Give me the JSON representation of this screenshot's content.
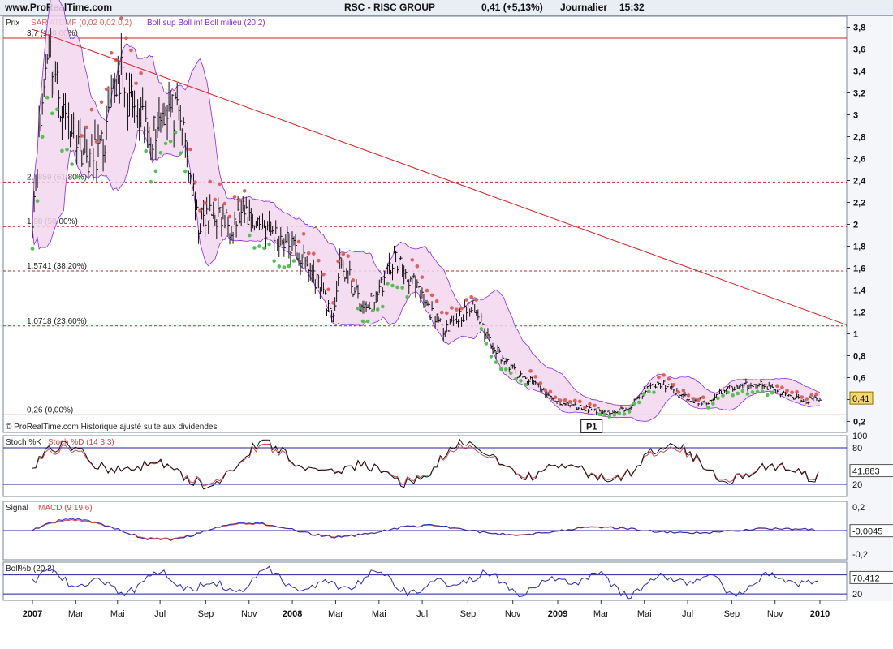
{
  "header": {
    "site": "www.ProRealTime.com",
    "ticker": "RSC - RISC GROUP",
    "price": "0,41 (+5,13%)",
    "period": "Journalier",
    "time": "15:32"
  },
  "colors": {
    "price_bars": "#111111",
    "sar_up": "#55c155",
    "sar_down": "#e06060",
    "bollinger_band": "#8a2be2",
    "bollinger_fill": "#f2d6ee",
    "fib_line": "#cc2222",
    "trend_line": "#dd2222",
    "stoch_k": "#111111",
    "stoch_d": "#d24a4a",
    "macd": "#2b2bb8",
    "signal": "#d24a4a",
    "bollpb": "#2b2bb8",
    "guide_line": "#22229a"
  },
  "chart_data": [
    {
      "type": "line",
      "panel": "price",
      "label": "Prix",
      "legend": [
        "SAR ATDMF (0,02 0,02 0,2)",
        "Boll sup Boll inf Boll milieu (20 2)"
      ],
      "ylim": [
        0.1,
        3.9
      ],
      "yticks": [
        "3,8",
        "3,6",
        "3,4",
        "3,2",
        "3",
        "2,8",
        "2,6",
        "2,4",
        "2,2",
        "2",
        "1,8",
        "1,6",
        "1,4",
        "1,2",
        "1",
        "0,8",
        "0,6",
        "0,4",
        "0,2"
      ],
      "x_labels": [
        {
          "label": "2007",
          "t": 0.0,
          "bold": true
        },
        {
          "label": "Mar",
          "t": 0.055
        },
        {
          "label": "Mai",
          "t": 0.108
        },
        {
          "label": "Jul",
          "t": 0.162
        },
        {
          "label": "Sep",
          "t": 0.22
        },
        {
          "label": "Nov",
          "t": 0.275
        },
        {
          "label": "2008",
          "t": 0.33,
          "bold": true
        },
        {
          "label": "Mar",
          "t": 0.385
        },
        {
          "label": "Mai",
          "t": 0.44
        },
        {
          "label": "Jul",
          "t": 0.495
        },
        {
          "label": "Sep",
          "t": 0.553
        },
        {
          "label": "Nov",
          "t": 0.61
        },
        {
          "label": "2009",
          "t": 0.667,
          "bold": true
        },
        {
          "label": "Mar",
          "t": 0.722
        },
        {
          "label": "Mai",
          "t": 0.777
        },
        {
          "label": "Jul",
          "t": 0.832
        },
        {
          "label": "Sep",
          "t": 0.888
        },
        {
          "label": "Nov",
          "t": 0.943
        },
        {
          "label": "2010",
          "t": 1.0,
          "bold": true
        }
      ],
      "fib_levels": [
        {
          "value": 3.7,
          "label": "3,7 (100,00%)"
        },
        {
          "value": 2.3859,
          "label": "2,3859 (61,80%)"
        },
        {
          "value": 1.98,
          "label": "1,98 (50,00%)"
        },
        {
          "value": 1.5741,
          "label": "1,5741 (38,20%)"
        },
        {
          "value": 1.0718,
          "label": "1,0718 (23,60%)"
        },
        {
          "value": 0.26,
          "label": "0,26 (0,00%)"
        }
      ],
      "trendline": {
        "from": [
          0.0,
          3.78
        ],
        "to": [
          1.0,
          1.17
        ]
      },
      "price_series": {
        "t": [
          0,
          0.01,
          0.02,
          0.03,
          0.04,
          0.05,
          0.07,
          0.09,
          0.11,
          0.13,
          0.15,
          0.17,
          0.19,
          0.21,
          0.23,
          0.25,
          0.27,
          0.29,
          0.31,
          0.33,
          0.35,
          0.37,
          0.38,
          0.39,
          0.4,
          0.42,
          0.44,
          0.46,
          0.48,
          0.5,
          0.52,
          0.54,
          0.56,
          0.58,
          0.6,
          0.62,
          0.64,
          0.66,
          0.68,
          0.7,
          0.72,
          0.74,
          0.76,
          0.78,
          0.8,
          0.82,
          0.84,
          0.86,
          0.88,
          0.9,
          0.92,
          0.94,
          0.96,
          0.98,
          1.0
        ],
        "close": [
          2.1,
          2.9,
          3.7,
          3.3,
          3.0,
          2.9,
          2.6,
          2.7,
          3.4,
          3.0,
          2.8,
          3.1,
          2.9,
          2.0,
          2.1,
          2.0,
          2.1,
          2.0,
          1.9,
          1.8,
          1.6,
          1.4,
          1.1,
          1.6,
          1.55,
          1.2,
          1.4,
          1.7,
          1.5,
          1.25,
          1.05,
          1.15,
          1.25,
          0.95,
          0.75,
          0.6,
          0.55,
          0.4,
          0.35,
          0.32,
          0.3,
          0.27,
          0.35,
          0.5,
          0.55,
          0.45,
          0.38,
          0.38,
          0.5,
          0.52,
          0.55,
          0.5,
          0.42,
          0.39,
          0.41
        ]
      },
      "last_value": "0,41",
      "annotation": "P1",
      "footnote": "© ProRealTime.com Historique ajusté suite aux dividendes"
    },
    {
      "type": "line",
      "panel": "stoch",
      "label": "Stoch %K",
      "label2": "Stoch %D (14 3 3)",
      "ylim": [
        0,
        100
      ],
      "yticks": [
        "100",
        "80",
        "20"
      ],
      "guides": [
        80,
        20
      ],
      "last_value": "41,883"
    },
    {
      "type": "line",
      "panel": "macd",
      "label": "Signal",
      "label2": "MACD (9 19 6)",
      "ylim": [
        -0.25,
        0.25
      ],
      "yticks": [
        "0,2",
        "-0,2"
      ],
      "guides": [
        0
      ],
      "last_value": "-0,0045"
    },
    {
      "type": "line",
      "panel": "bollpb",
      "label": "Boll%b (20 2)",
      "ylim": [
        0,
        120
      ],
      "yticks": [
        "20"
      ],
      "guides": [
        80,
        20
      ],
      "last_value": "70,412"
    }
  ]
}
